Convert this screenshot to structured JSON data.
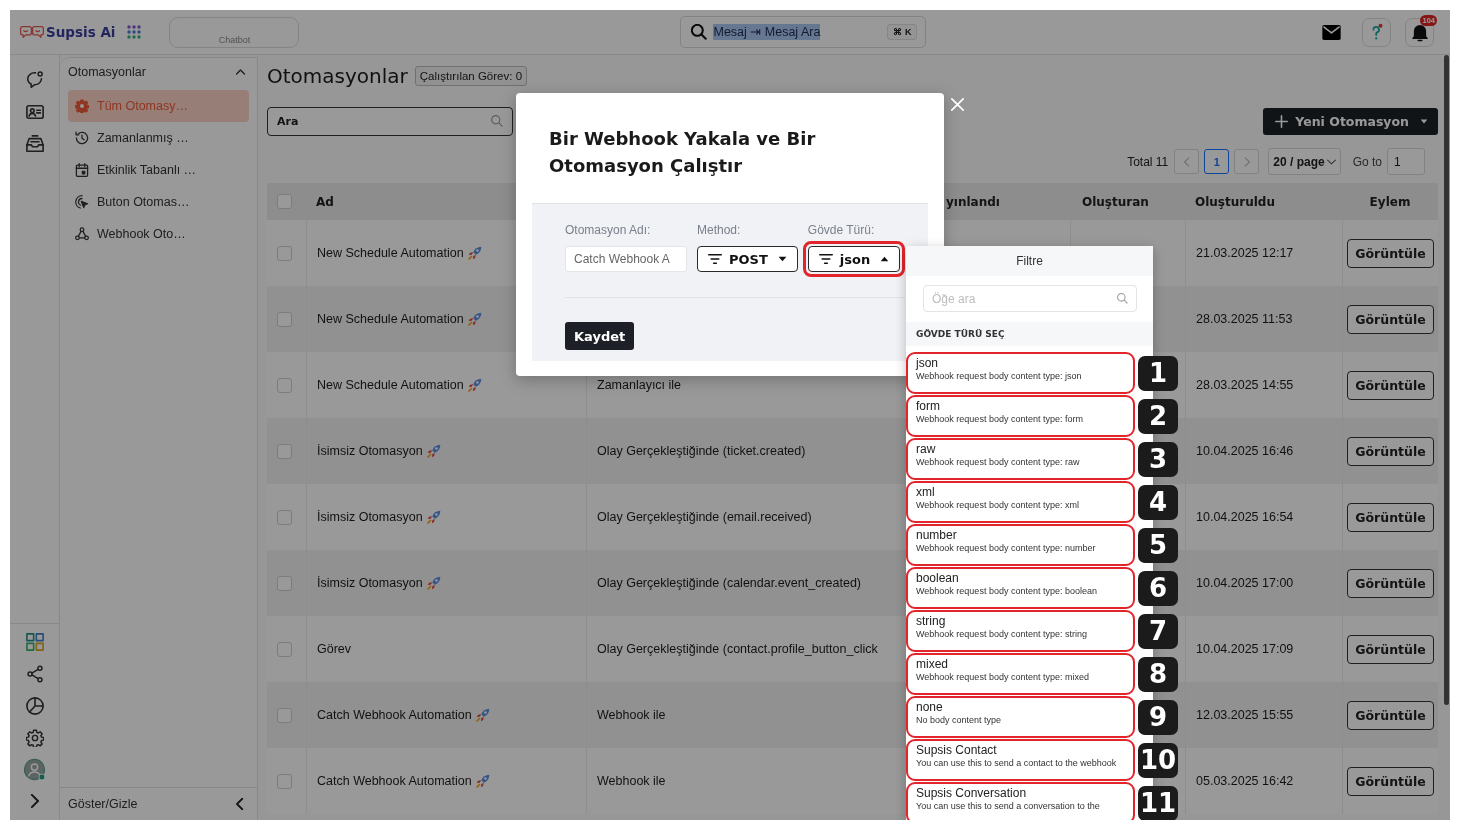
{
  "header": {
    "brand": "Supsis Ai",
    "tab": "Chatbot",
    "search": {
      "value": "Mesaj ⇥ Mesaj Ara",
      "text_selected": true,
      "shortcut": "⌘ K"
    },
    "notification_count": "104"
  },
  "sidebar": {
    "title": "Otomasyonlar",
    "expanded": true,
    "items": [
      {
        "kind": "all",
        "label": "Tüm Otomasy…",
        "selected": true
      },
      {
        "kind": "scheduled",
        "label": "Zamanlanmış …",
        "selected": false
      },
      {
        "kind": "event",
        "label": "Etkinlik Tabanlı …",
        "selected": false
      },
      {
        "kind": "button",
        "label": "Buton Otomas…",
        "selected": false
      },
      {
        "kind": "webhook",
        "label": "Webhook Oto…",
        "selected": false
      }
    ],
    "footer": "Göster/Gizle"
  },
  "page": {
    "title": "Otomasyonlar",
    "running_badge": "Çalıştırılan Görev: 0",
    "search": {
      "placeholder": "Ara"
    },
    "new_button": "Yeni Otomasyon",
    "pagination": {
      "total": "Total 11",
      "pages": [
        {
          "label": "1",
          "selected": true
        }
      ],
      "page_size": "20 / page",
      "goto_label": "Go to",
      "goto_value": "1"
    }
  },
  "table": {
    "select_all": {
      "checked": false
    },
    "columns": {
      "name": "Ad",
      "column_3": "yınlandı",
      "creator": "Oluşturan",
      "created": "Oluşturuldu",
      "action": "Eylem"
    },
    "rows": [
      {
        "checked": false,
        "name": "New Schedule Automation",
        "emoji": true,
        "created": "21.03.2025 12:17",
        "action": "Görüntüle"
      },
      {
        "checked": false,
        "name": "New Schedule Automation",
        "emoji": true,
        "created": "28.03.2025 11:53",
        "action": "Görüntüle"
      },
      {
        "checked": false,
        "name": "New Schedule Automation",
        "emoji": true,
        "column_2": "Zamanlayıcı ile",
        "created": "28.03.2025 14:55",
        "action": "Görüntüle"
      },
      {
        "checked": false,
        "name": "İsimsiz Otomasyon",
        "emoji": true,
        "column_2": "Olay Gerçekleştiğinde (ticket.created)",
        "created": "10.04.2025 16:46",
        "action": "Görüntüle"
      },
      {
        "checked": false,
        "name": "İsimsiz Otomasyon",
        "emoji": true,
        "column_2": "Olay Gerçekleştiğinde (email.received)",
        "created": "10.04.2025 16:54",
        "action": "Görüntüle"
      },
      {
        "checked": false,
        "name": "İsimsiz Otomasyon",
        "emoji": true,
        "column_2": "Olay Gerçekleştiğinde (calendar.event_created)",
        "created": "10.04.2025 17:00",
        "action": "Görüntüle"
      },
      {
        "checked": false,
        "name": "Görev",
        "emoji": false,
        "column_2": "Olay Gerçekleştiğinde (contact.profile_button_click",
        "created": "10.04.2025 17:09",
        "action": "Görüntüle"
      },
      {
        "checked": false,
        "name": "Catch Webhook Automation",
        "emoji": true,
        "column_2": "Webhook ile",
        "created": "12.03.2025 15:55",
        "action": "Görüntüle"
      },
      {
        "checked": false,
        "name": "Catch Webhook Automation",
        "emoji": true,
        "column_2": "Webhook ile",
        "created": "05.03.2025 16:42",
        "action": "Görüntüle"
      }
    ]
  },
  "modal": {
    "title": "Bir Webhook Yakala ve Bir Otomasyon Çalıştır",
    "fields": [
      {
        "kind": "input",
        "label": "Otomasyon Adı:",
        "value": "Catch Webhook A"
      },
      {
        "kind": "select",
        "label": "Method:",
        "value": "POST",
        "open": false,
        "outlined": false
      },
      {
        "kind": "select",
        "label": "Gövde Türü:",
        "value": "json",
        "open": true,
        "outlined": true,
        "menu": {
          "title": "Filtre",
          "search": {
            "placeholder": "Öğe ara"
          },
          "section": "GÖVDE TÜRÜ SEÇ",
          "options": [
            {
              "title": "json",
              "description": "Webhook request body content type: json",
              "outlined": true,
              "marker": "1"
            },
            {
              "title": "form",
              "description": "Webhook request body content type: form",
              "outlined": true,
              "marker": "2"
            },
            {
              "title": "raw",
              "description": "Webhook request body content type: raw",
              "outlined": true,
              "marker": "3"
            },
            {
              "title": "xml",
              "description": "Webhook request body content type: xml",
              "outlined": true,
              "marker": "4"
            },
            {
              "title": "number",
              "description": "Webhook request body content type: number",
              "outlined": true,
              "marker": "5"
            },
            {
              "title": "boolean",
              "description": "Webhook request body content type: boolean",
              "outlined": true,
              "marker": "6"
            },
            {
              "title": "string",
              "description": "Webhook request body content type: string",
              "outlined": true,
              "marker": "7"
            },
            {
              "title": "mixed",
              "description": "Webhook request body content type: mixed",
              "outlined": true,
              "marker": "8"
            },
            {
              "title": "none",
              "description": "No body content type",
              "outlined": true,
              "marker": "9"
            },
            {
              "title": "Supsis Contact",
              "description": "You can use this to send a contact to the webhook",
              "outlined": true,
              "marker": "10"
            },
            {
              "title": "Supsis Conversation",
              "description": "You can use this to send a conversation to the",
              "outlined": true,
              "marker": "11"
            }
          ]
        }
      }
    ],
    "save": "Kaydet"
  }
}
